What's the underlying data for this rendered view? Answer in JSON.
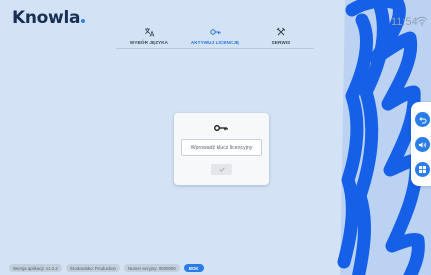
{
  "app": {
    "logo": "Knowla",
    "time": "11:54"
  },
  "colors": {
    "accent": "#2473d6",
    "brand_stroke": "#1560e8",
    "background": "#d3e2f5"
  },
  "tabs": [
    {
      "label": "WYBÓR JĘZYKA",
      "icon": "translate-icon",
      "active": false
    },
    {
      "label": "AKTYWUJ LICENCJĘ",
      "icon": "key-icon",
      "active": true
    },
    {
      "label": "SERWIS",
      "icon": "tools-icon",
      "active": false
    }
  ],
  "license": {
    "placeholder": "Wprowadź klucz licencyjny",
    "value": "",
    "confirm_icon": "check-icon"
  },
  "sidebar": {
    "buttons": [
      {
        "icon": "undo-icon"
      },
      {
        "icon": "volume-icon"
      },
      {
        "icon": "windows-icon"
      }
    ]
  },
  "footer": {
    "version": "Wersja aplikacji: v1.2.2",
    "environment": "Środowisko: Production",
    "serial": "Numer seryjny: 0000000",
    "ok_label": "BOK"
  }
}
